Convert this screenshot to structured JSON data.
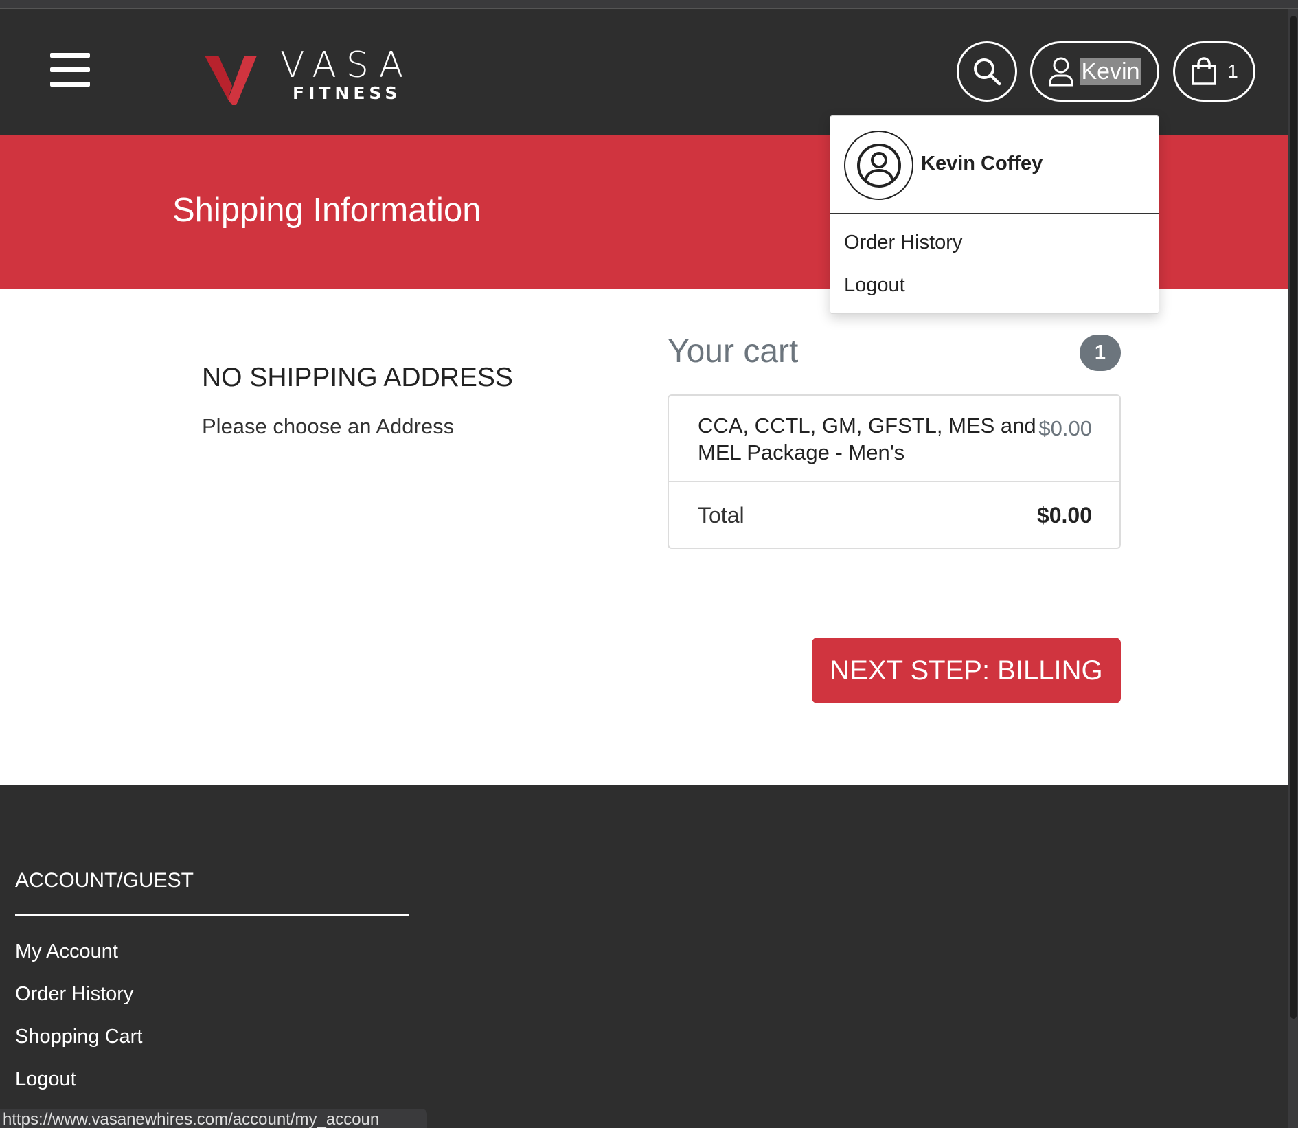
{
  "header": {
    "brand_line1": "VASA",
    "brand_line2": "FITNESS",
    "user_label": "Kevin",
    "cart_count": "1"
  },
  "banner": {
    "title": "Shipping Information"
  },
  "dropdown": {
    "full_name": "Kevin Coffey",
    "items": [
      {
        "label": "Order History"
      },
      {
        "label": "Logout"
      }
    ]
  },
  "shipping": {
    "heading": "NO SHIPPING ADDRESS",
    "subtext": "Please choose an Address"
  },
  "cart": {
    "title": "Your cart",
    "badge": "1",
    "item_name": "CCA, CCTL, GM, GFSTL, MES and MEL Package - Men's",
    "item_price": "$0.00",
    "total_label": "Total",
    "total_value": "$0.00"
  },
  "next_button": "NEXT STEP: BILLING",
  "footer": {
    "heading": "ACCOUNT/GUEST",
    "links": [
      {
        "label": "My Account"
      },
      {
        "label": "Order History"
      },
      {
        "label": "Shopping Cart"
      },
      {
        "label": "Logout"
      }
    ]
  },
  "status_url": "https://www.vasanewhires.com/account/my_accoun",
  "colors": {
    "brand_red": "#d0343f",
    "header_dark": "#2e2e2e",
    "muted_gray": "#6c757d"
  }
}
